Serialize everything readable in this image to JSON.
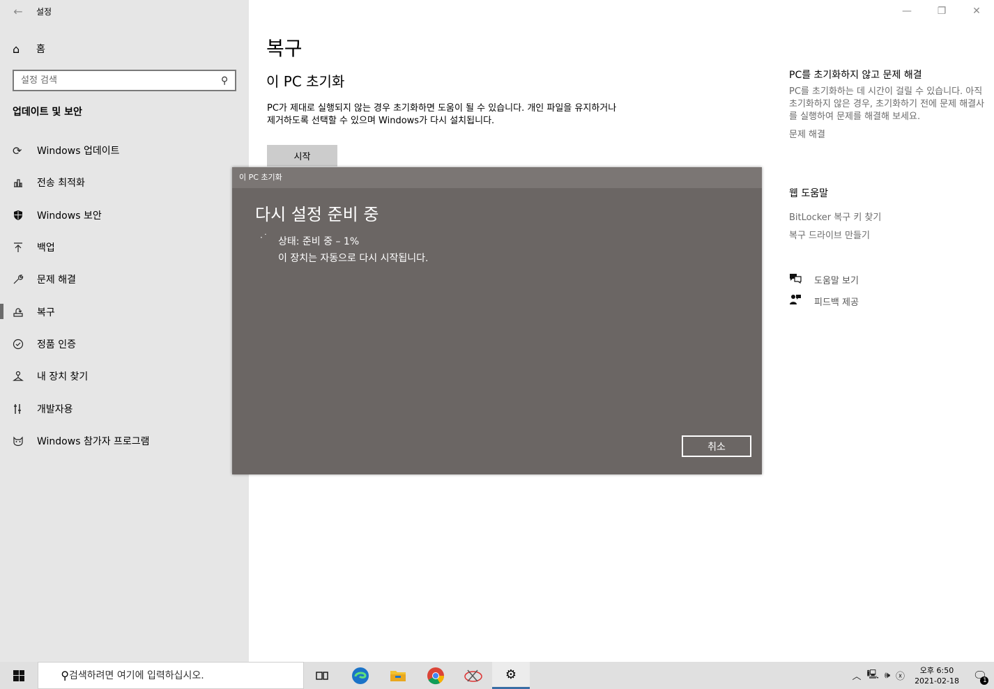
{
  "app": {
    "title": "설정",
    "back_icon": "back-arrow-icon"
  },
  "sidebar": {
    "home_label": "홈",
    "search_placeholder": "설정 검색",
    "section_title": "업데이트 및 보안",
    "items": [
      {
        "label": "Windows 업데이트",
        "icon": "sync-icon"
      },
      {
        "label": "전송 최적화",
        "icon": "delivery-optimization-icon"
      },
      {
        "label": "Windows 보안",
        "icon": "shield-icon"
      },
      {
        "label": "백업",
        "icon": "backup-arrow-icon"
      },
      {
        "label": "문제 해결",
        "icon": "wrench-icon"
      },
      {
        "label": "복구",
        "icon": "recovery-icon",
        "active": true
      },
      {
        "label": "정품 인증",
        "icon": "check-circle-icon"
      },
      {
        "label": "내 장치 찾기",
        "icon": "find-device-icon"
      },
      {
        "label": "개발자용",
        "icon": "developer-icon"
      },
      {
        "label": "Windows 참가자 프로그램",
        "icon": "insider-icon"
      }
    ]
  },
  "main": {
    "page_title": "복구",
    "section_title": "이 PC 초기화",
    "description": "PC가 제대로 실행되지 않는 경우 초기화하면 도움이 될 수 있습니다. 개인 파일을 유지하거나 제거하도록 선택할 수 있으며 Windows가 다시 설치됩니다.",
    "start_button": "시작"
  },
  "right_panel": {
    "title": "PC를 초기화하지 않고 문제 해결",
    "text": "PC를 초기화하는 데 시간이 걸릴 수 있습니다. 아직 초기화하지 않은 경우, 초기화하기 전에 문제 해결사를 실행하여 문제를 해결해 보세요.",
    "link": "문제 해결",
    "web_help_title": "웹 도움말",
    "web_links": [
      "BitLocker 복구 키 찾기",
      "복구 드라이브 만들기"
    ],
    "get_help": "도움말 보기",
    "feedback": "피드백 제공"
  },
  "dialog": {
    "title": "이 PC 초기화",
    "heading": "다시 설정 준비 중",
    "status": "상태: 준비 중 – 1%",
    "note": "이 장치는 자동으로 다시 시작됩니다.",
    "cancel": "취소"
  },
  "taskbar": {
    "search_placeholder": "검색하려면 여기에 입력하십시오.",
    "time": "오후 6:50",
    "date": "2021-02-18",
    "notification_count": "1"
  }
}
